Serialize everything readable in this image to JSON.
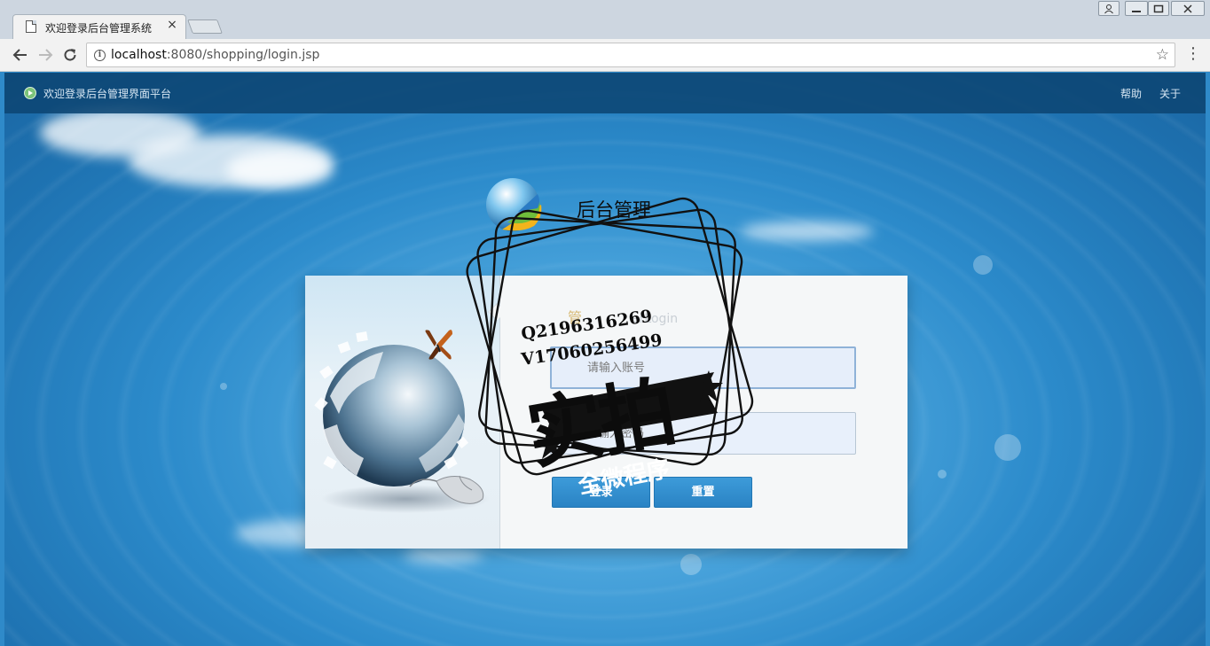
{
  "browser": {
    "tab_title": "欢迎登录后台管理系统",
    "tab_close": "×",
    "url_host": "localhost",
    "url_rest": ":8080/shopping/login.jsp",
    "icons": [
      "page-icon",
      "back-icon",
      "forward-icon",
      "reload-icon",
      "info-icon",
      "star-icon",
      "menu-icon",
      "user-icon",
      "minimize-icon",
      "restore-icon",
      "close-icon"
    ]
  },
  "topbar": {
    "title": "欢迎登录后台管理界面平台",
    "help": "帮助",
    "about": "关于"
  },
  "logo": {
    "title": "后台管理"
  },
  "login": {
    "heading_cn": "管",
    "heading_en": "erLogin",
    "username_placeholder": "请输入账号",
    "password_placeholder": "请输入密码",
    "login_button": "登录",
    "reset_button": "重置"
  },
  "watermark": {
    "line1": "Q2196316269",
    "line2": "V17060256499",
    "big_text": "实拍",
    "ribbon_text": "全微程序"
  },
  "colors": {
    "topbar": "#0c4673",
    "button": "#2a83c4",
    "page_background": "#2f8ac9"
  }
}
